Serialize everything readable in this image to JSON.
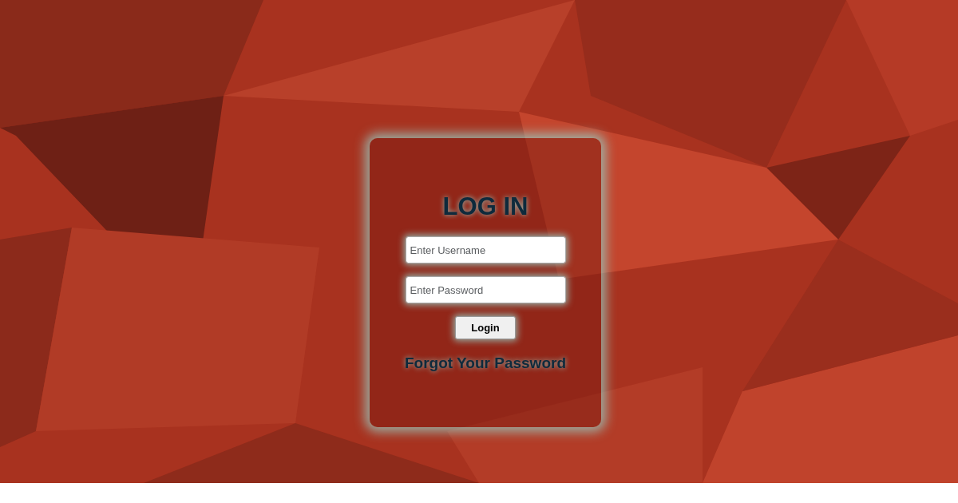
{
  "title": "LOG IN",
  "username": {
    "placeholder": "Enter Username"
  },
  "password": {
    "placeholder": "Enter Password"
  },
  "login_button": "Login",
  "forgot_link": "Forgot Your Password"
}
